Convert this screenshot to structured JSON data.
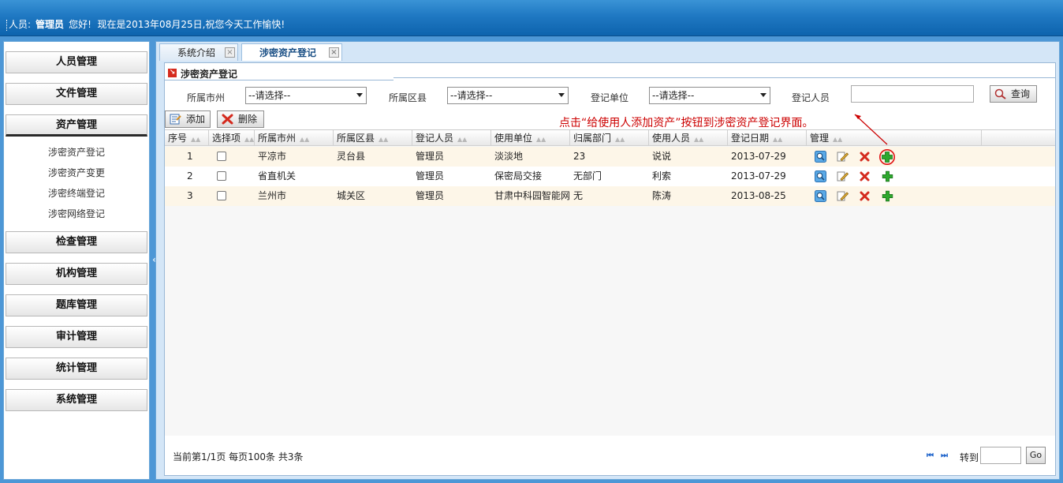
{
  "header": {
    "user_label": "人员:",
    "user_name": "管理员",
    "greeting": "您好!",
    "date_message": "现在是2013年08月25日,祝您今天工作愉快!"
  },
  "sidebar": {
    "menus": [
      {
        "label": "人员管理"
      },
      {
        "label": "文件管理"
      },
      {
        "label": "资产管理"
      },
      {
        "label": "检查管理"
      },
      {
        "label": "机构管理"
      },
      {
        "label": "题库管理"
      },
      {
        "label": "审计管理"
      },
      {
        "label": "统计管理"
      },
      {
        "label": "系统管理"
      }
    ],
    "submenu": [
      {
        "label": "涉密资产登记"
      },
      {
        "label": "涉密资产变更"
      },
      {
        "label": "涉密终端登记"
      },
      {
        "label": "涉密网络登记"
      }
    ],
    "collapse_glyph": "«"
  },
  "tabs": [
    {
      "label": "系统介绍"
    },
    {
      "label": "涉密资产登记"
    }
  ],
  "panel": {
    "title": "涉密资产登记"
  },
  "filters": {
    "city_label": "所属市州",
    "city_value": "--请选择--",
    "district_label": "所属区县",
    "district_value": "--请选择--",
    "unit_label": "登记单位",
    "unit_value": "--请选择--",
    "person_label": "登记人员",
    "person_value": "",
    "query_label": "查询"
  },
  "toolbar": {
    "add_label": "添加",
    "delete_label": "删除",
    "annotation": "点击“给使用人添加资产”按钮到涉密资产登记界面。"
  },
  "table": {
    "columns": [
      "序号",
      "选择项",
      "所属市州",
      "所属区县",
      "登记人员",
      "使用单位",
      "归属部门",
      "使用人员",
      "登记日期",
      "管理"
    ],
    "rows": [
      {
        "no": "1",
        "city": "平凉市",
        "district": "灵台县",
        "registrar": "管理员",
        "unit": "淡淡地",
        "dept": "23",
        "user": "说说",
        "date": "2013-07-29"
      },
      {
        "no": "2",
        "city": "省直机关",
        "district": "",
        "registrar": "管理员",
        "unit": "保密局交接",
        "dept": "无部门",
        "user": "利索",
        "date": "2013-07-29"
      },
      {
        "no": "3",
        "city": "兰州市",
        "district": "城关区",
        "registrar": "管理员",
        "unit": "甘肃中科园智能网",
        "dept": "无",
        "user": "陈涛",
        "date": "2013-08-25"
      }
    ],
    "actions": [
      "view-icon",
      "edit-icon",
      "delete-icon",
      "add-asset-icon"
    ]
  },
  "pager": {
    "info": "当前第1/1页 每页100条 共3条",
    "first_glyph": "⏮",
    "last_glyph": "⏭",
    "goto_label": "转到",
    "go_label": "Go"
  },
  "colors": {
    "header_blue": "#1f78c2",
    "annotation_red": "#cc0000",
    "odd_row": "#fdf6e8",
    "add_green": "#2ea82e"
  }
}
